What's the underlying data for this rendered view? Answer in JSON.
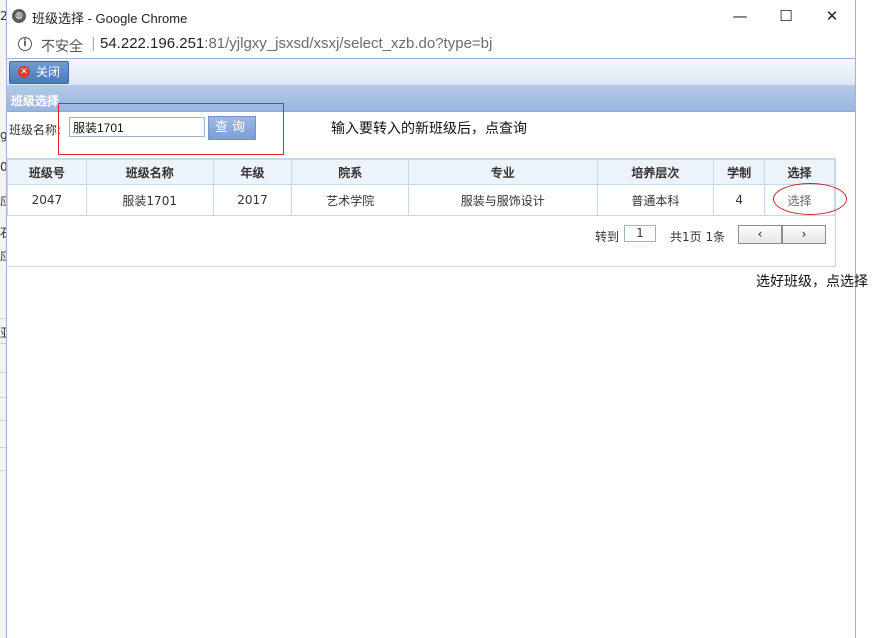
{
  "background": {
    "fragments": [
      "2.",
      "g",
      "0",
      "应",
      "石",
      "应",
      "亚"
    ]
  },
  "window": {
    "title": "班级选择 - Google Chrome",
    "controls": {
      "minimize": "—",
      "maximize": "☐",
      "close": "✕"
    }
  },
  "address_bar": {
    "security_label": "不安全",
    "separator": "|",
    "url_host": "54.222.196.251",
    "url_rest": ":81/yjlgxy_jsxsd/xsxj/select_xzb.do?type=bj"
  },
  "toolbar": {
    "close_label": "关闭"
  },
  "panel": {
    "title": "班级选择"
  },
  "search": {
    "label": "班级名称:",
    "value": "服装1701",
    "button_label": "查询"
  },
  "annotations": {
    "search_hint": "输入要转入的新班级后，点查询",
    "select_hint": "选好班级，点选择"
  },
  "table": {
    "headers": [
      "班级号",
      "班级名称",
      "年级",
      "院系",
      "专业",
      "培养层次",
      "学制",
      "选择"
    ],
    "rows": [
      [
        "2047",
        "服装1701",
        "2017",
        "艺术学院",
        "服装与服饰设计",
        "普通本科",
        "4",
        "选择"
      ]
    ]
  },
  "pager": {
    "goto_label": "转到",
    "page_value": "1",
    "info": "共1页 1条",
    "prev": "‹",
    "next": "›"
  }
}
